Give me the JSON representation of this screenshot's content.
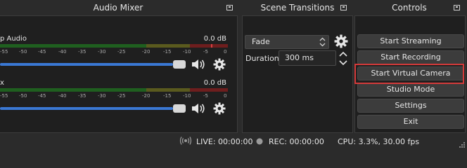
{
  "audio_mixer": {
    "title": "Audio Mixer",
    "channels": [
      {
        "name": "p Audio",
        "db": "0.0 dB"
      },
      {
        "name": "x",
        "db": "0.0 dB"
      }
    ],
    "ticks": [
      "-55",
      "-50",
      "-45",
      "-40",
      "-35",
      "-30",
      "-25",
      "-20",
      "-15",
      "-10",
      "-5",
      "0"
    ]
  },
  "scene_transitions": {
    "title": "Scene Transitions",
    "transition": "Fade",
    "duration_label": "Duration",
    "duration_value": "300 ms"
  },
  "controls": {
    "title": "Controls",
    "buttons": [
      "Start Streaming",
      "Start Recording",
      "Start Virtual Camera",
      "Studio Mode",
      "Settings",
      "Exit"
    ]
  },
  "status": {
    "live": "LIVE: 00:00:00",
    "rec": "REC: 00:00:00",
    "cpu": "CPU: 3.3%, 30.00 fps"
  },
  "colors": {
    "highlight": "#d53a3a",
    "volume_slider": "#3a78d4",
    "meter_green": "#1f5f1f",
    "meter_yellow": "#5a5a1e",
    "meter_red": "#6e1e1e"
  }
}
